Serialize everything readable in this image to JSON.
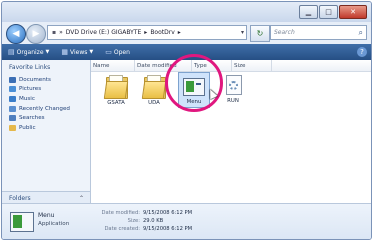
{
  "address_bar": {
    "crumbs": [
      "DVD Drive (E:) GIGABYTE",
      "BootDrv"
    ],
    "search_placeholder": "Search"
  },
  "toolbar": {
    "organize": "Organize",
    "views": "Views",
    "open": "Open"
  },
  "nav_pane": {
    "title": "Favorite Links",
    "links": [
      {
        "label": "Documents",
        "color": "#3c6fb5"
      },
      {
        "label": "Pictures",
        "color": "#4b8fd6"
      },
      {
        "label": "Music",
        "color": "#3a7dc9"
      },
      {
        "label": "Recently Changed",
        "color": "#5a8fd0"
      },
      {
        "label": "Searches",
        "color": "#4f7fbf"
      },
      {
        "label": "Public",
        "color": "#e5b84b"
      }
    ],
    "folders_label": "Folders"
  },
  "columns": [
    "Name",
    "Date modified",
    "Type",
    "Size"
  ],
  "files": [
    {
      "name": "GSATA",
      "kind": "folder"
    },
    {
      "name": "UDA",
      "kind": "folder"
    },
    {
      "name": "Menu",
      "kind": "application",
      "selected": true
    },
    {
      "name": "RUN",
      "kind": "script"
    }
  ],
  "details": {
    "name": "Menu",
    "type": "Application",
    "date_modified_label": "Date modified:",
    "date_modified": "9/15/2008 6:12 PM",
    "size_label": "Size:",
    "size": "29.0 KB",
    "date_created_label": "Date created:",
    "date_created": "9/15/2008 6:12 PM"
  },
  "colors": {
    "highlight_ring": "#e0177f",
    "toolbar": "#2f5d97",
    "selection": "#cfe3fb"
  }
}
